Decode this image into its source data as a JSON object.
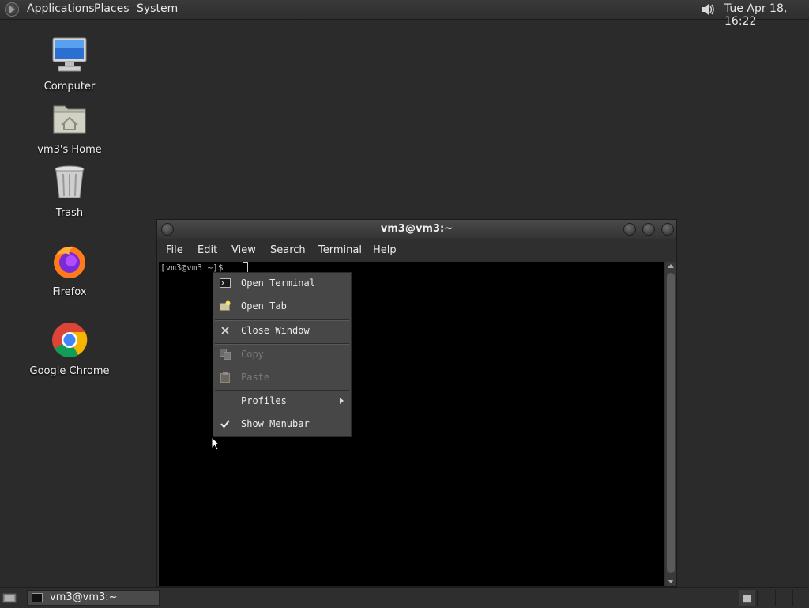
{
  "top_panel": {
    "menus": [
      "Applications",
      "Places",
      "System"
    ],
    "clock": "Tue Apr 18, 16:22"
  },
  "desktop_icons": [
    {
      "label": "Computer",
      "icon": "computer-icon"
    },
    {
      "label": "vm3's Home",
      "icon": "home-folder-icon"
    },
    {
      "label": "Trash",
      "icon": "trash-icon"
    },
    {
      "label": "Firefox",
      "icon": "firefox-icon"
    },
    {
      "label": "Google Chrome",
      "icon": "chrome-icon"
    }
  ],
  "terminal": {
    "title": "vm3@vm3:~",
    "menus": [
      "File",
      "Edit",
      "View",
      "Search",
      "Terminal",
      "Help"
    ],
    "prompt": "[vm3@vm3 ~]$ "
  },
  "context_menu": {
    "items": [
      {
        "label": "Open Terminal",
        "icon": "terminal-icon",
        "enabled": true
      },
      {
        "label": "Open Tab",
        "icon": "new-tab-icon",
        "enabled": true
      },
      {
        "label": "Close Window",
        "icon": "close-icon",
        "enabled": true
      },
      {
        "label": "Copy",
        "icon": "copy-icon",
        "enabled": false
      },
      {
        "label": "Paste",
        "icon": "paste-icon",
        "enabled": false
      },
      {
        "label": "Profiles",
        "icon": "",
        "enabled": true,
        "submenu": true
      },
      {
        "label": "Show Menubar",
        "icon": "checkmark-icon",
        "enabled": true,
        "checked": true
      }
    ]
  },
  "taskbar": {
    "tasks": [
      {
        "label": "vm3@vm3:~"
      }
    ]
  }
}
